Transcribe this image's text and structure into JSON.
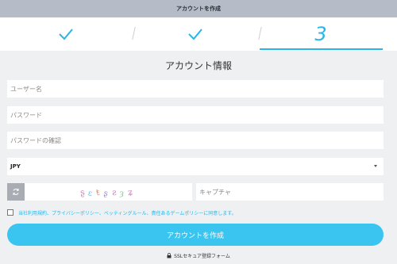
{
  "window": {
    "title": "アカウントを作成"
  },
  "steps": {
    "items": [
      {
        "state": "complete",
        "icon": "checkmark-icon"
      },
      {
        "state": "complete",
        "icon": "checkmark-icon"
      },
      {
        "state": "active",
        "label": "3"
      }
    ],
    "accent_color": "#27b6e8"
  },
  "form": {
    "heading": "アカウント情報",
    "username": {
      "placeholder": "ユーザー名",
      "value": ""
    },
    "password": {
      "placeholder": "パスワード",
      "value": ""
    },
    "password_confirm": {
      "placeholder": "パスワードの確認",
      "value": ""
    },
    "currency": {
      "selected": "JPY"
    },
    "captcha": {
      "placeholder": "キャプチャ",
      "value": "",
      "refresh_icon": "refresh-icon"
    },
    "terms": {
      "checked": false,
      "label": "当社利用規約、プライバシーポリシー、ベッティングルール、責任あるゲームポリシーに同意します。"
    },
    "submit_label": "アカウントを作成",
    "ssl_note": "SSLセキュア登録フォーム",
    "ssl_icon": "lock-icon"
  },
  "colors": {
    "title_bar": "#b5bcc7",
    "primary_button": "#39c5ef",
    "link": "#27b6e8"
  }
}
